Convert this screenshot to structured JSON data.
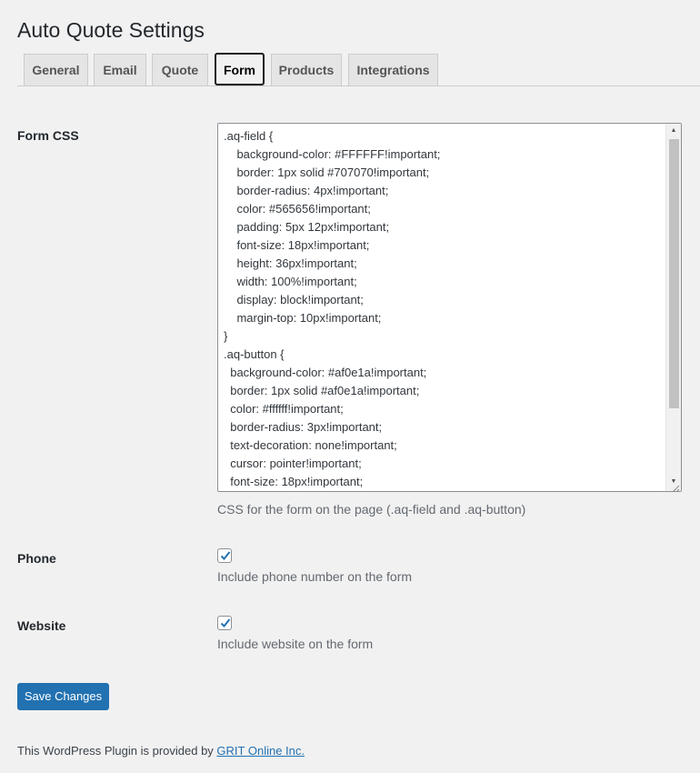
{
  "page": {
    "title": "Auto Quote Settings"
  },
  "tabs": [
    {
      "label": "General"
    },
    {
      "label": "Email"
    },
    {
      "label": "Quote"
    },
    {
      "label": "Form",
      "active": true
    },
    {
      "label": "Products"
    },
    {
      "label": "Integrations"
    }
  ],
  "form_css": {
    "label": "Form CSS",
    "value": ".aq-field {\n\tbackground-color: #FFFFFF!important;\n\tborder: 1px solid #707070!important;\n\tborder-radius: 4px!important;\n\tcolor: #565656!important;\n\tpadding: 5px 12px!important;\n\tfont-size: 18px!important;\n\theight: 36px!important;\n\twidth: 100%!important;\n\tdisplay: block!important;\n\tmargin-top: 10px!important;\n}\n.aq-button {\n  background-color: #af0e1a!important;\n  border: 1px solid #af0e1a!important;\n  color: #ffffff!important;\n  border-radius: 3px!important;\n  text-decoration: none!important;\n  cursor: pointer!important;\n  font-size: 18px!important;",
    "description": "CSS for the form on the page (.aq-field and .aq-button)"
  },
  "phone": {
    "label": "Phone",
    "checked": true,
    "description": "Include phone number on the form"
  },
  "website": {
    "label": "Website",
    "checked": true,
    "description": "Include website on the form"
  },
  "actions": {
    "save_label": "Save Changes"
  },
  "footer": {
    "text": "This WordPress Plugin is provided by ",
    "link_text": "GRIT Online Inc."
  },
  "colors": {
    "accent": "#2271b1",
    "background": "#f1f1f1",
    "active_tab_border": "#1e1e1e"
  },
  "icons": {
    "checkbox_check": "checkmark-icon",
    "scroll_up": "arrow-up-icon",
    "scroll_down": "arrow-down-icon",
    "resize": "resize-grip-icon"
  }
}
